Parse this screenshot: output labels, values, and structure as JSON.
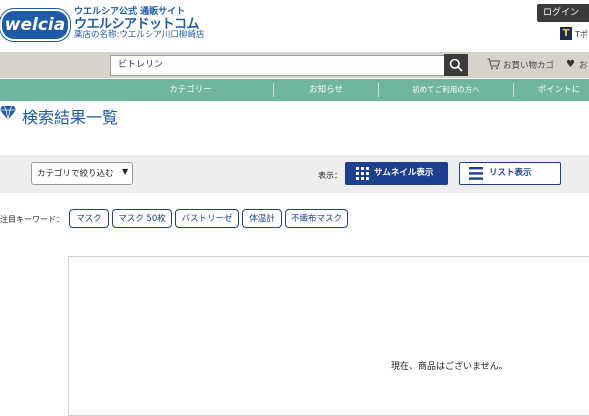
{
  "header": {
    "logo_text": "welcia",
    "brand_line1": "ウエルシア公式 通販サイト",
    "brand_line2": "ウエルシアドットコム",
    "pharmacy_name": "薬店の名称:ウエルシア川口柳崎店",
    "login_label": "ログイン",
    "tpoint_label": "Tポ"
  },
  "search": {
    "value": "ビトレリン",
    "button_icon": "search-icon"
  },
  "utility": {
    "cart_label": "お買い物カゴ",
    "favorites_label": "お"
  },
  "nav": {
    "items": [
      {
        "label": "カテゴリー"
      },
      {
        "label": "お知らせ"
      },
      {
        "label": "初めてご利用の方へ"
      },
      {
        "label": "ポイントに"
      }
    ]
  },
  "page": {
    "title": "検索結果一覧"
  },
  "toolbar": {
    "category_select_value": "カテゴリで絞り込む",
    "display_label": "表示：",
    "thumbnail_label": "サムネイル表示",
    "list_label": "リスト表示"
  },
  "keywords": {
    "label": "注目キーワード：",
    "items": [
      {
        "label": "マスク"
      },
      {
        "label": "マスク 50枚"
      },
      {
        "label": "バストリーゼ"
      },
      {
        "label": "体温計"
      },
      {
        "label": "不織布マスク"
      }
    ]
  },
  "results": {
    "empty_message": "現在、商品はございません。"
  },
  "colors": {
    "brand_blue": "#1d5ba8",
    "nav_green": "#70b59f",
    "button_navy": "#1d3f8f",
    "search_band": "#d6d3c9"
  }
}
